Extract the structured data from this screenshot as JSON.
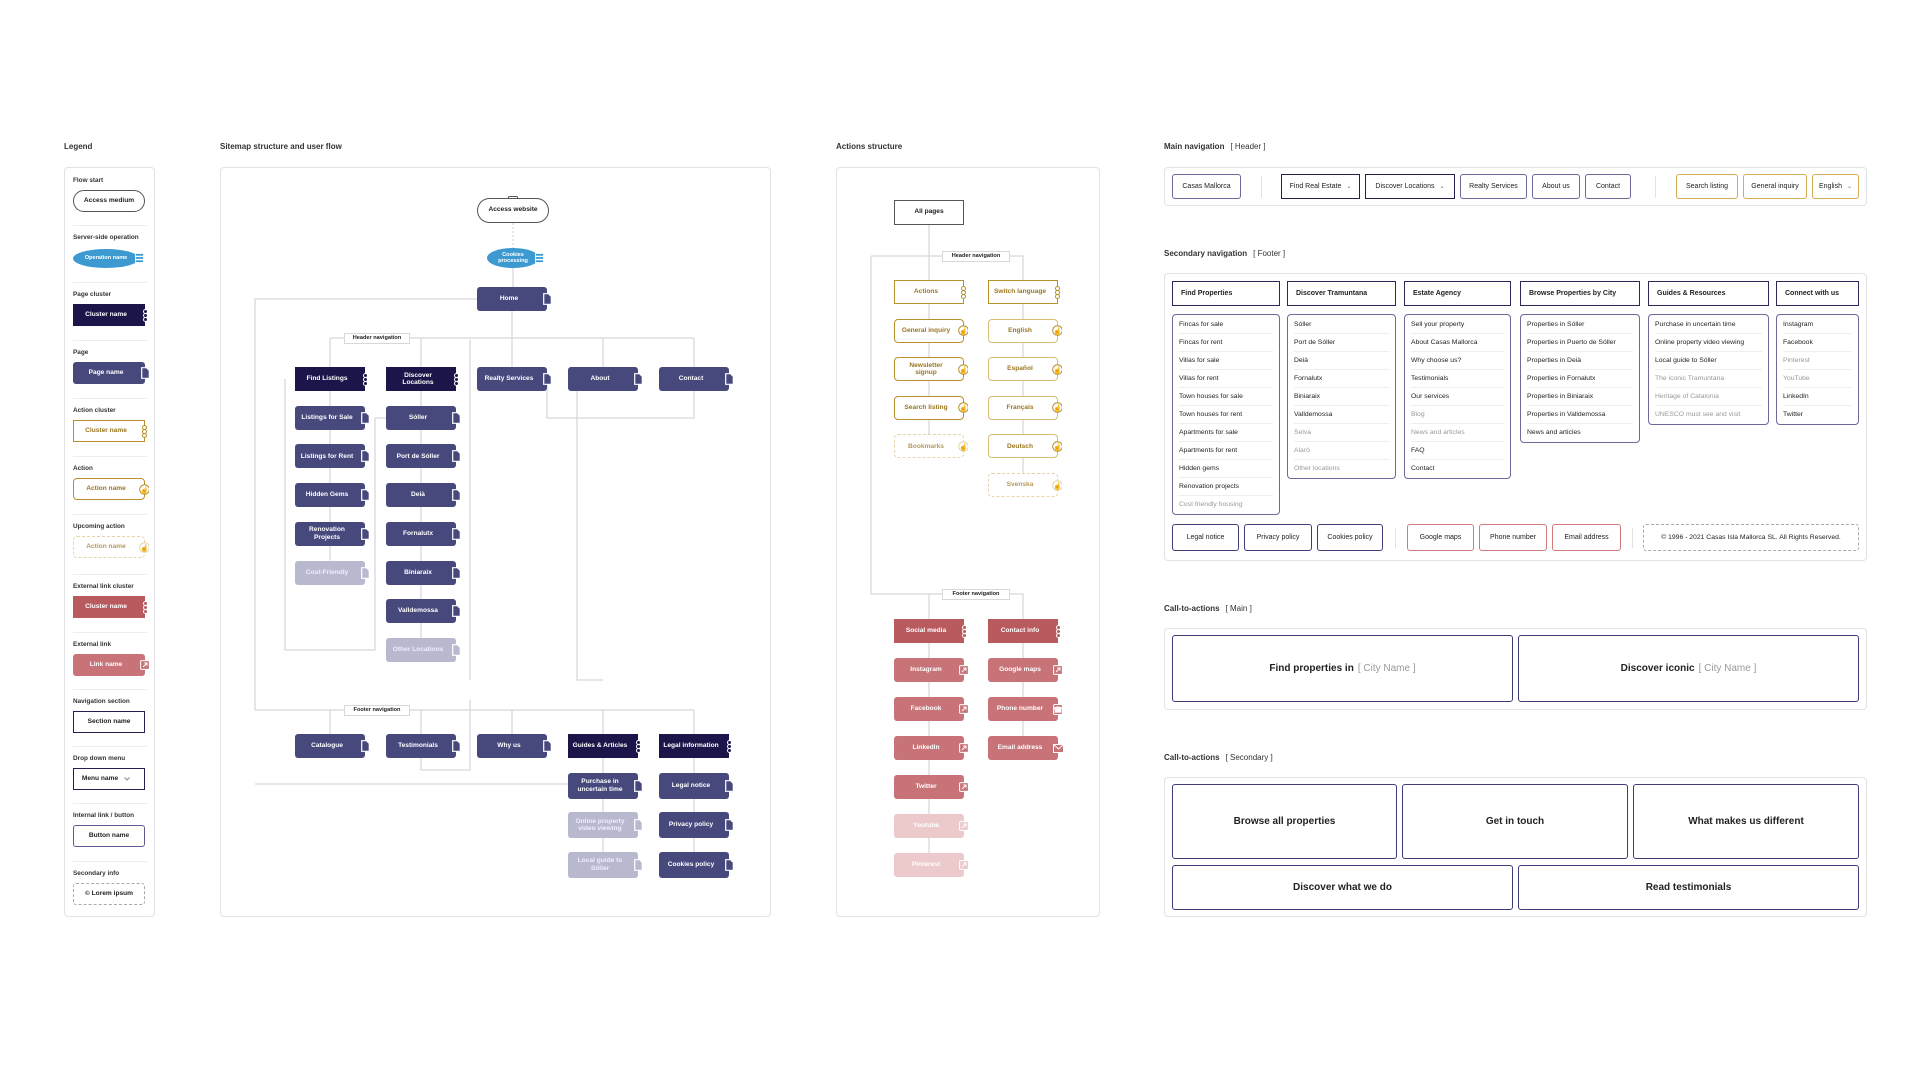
{
  "legend": {
    "title": "Legend",
    "items": [
      {
        "label": "Flow start",
        "sample": "Access medium",
        "kind": "flow"
      },
      {
        "label": "Server-side operation",
        "sample": "Operation name",
        "kind": "server"
      },
      {
        "label": "Page cluster",
        "sample": "Cluster name",
        "kind": "cluster"
      },
      {
        "label": "Page",
        "sample": "Page name",
        "kind": "page"
      },
      {
        "label": "Action cluster",
        "sample": "Cluster name",
        "kind": "action-cluster"
      },
      {
        "label": "Action",
        "sample": "Action name",
        "kind": "action"
      },
      {
        "label": "Upcoming action",
        "sample": "Action name",
        "kind": "action-up"
      },
      {
        "label": "External link cluster",
        "sample": "Cluster name",
        "kind": "ext-cluster"
      },
      {
        "label": "External link",
        "sample": "Link name",
        "kind": "ext"
      },
      {
        "label": "Navigation section",
        "sample": "Section name",
        "kind": "nav"
      },
      {
        "label": "Drop down menu",
        "sample": "Menu name",
        "kind": "dropdown"
      },
      {
        "label": "Internal link / button",
        "sample": "Button name",
        "kind": "button"
      },
      {
        "label": "Secondary info",
        "sample": "© Lorem ipsum",
        "kind": "secondary"
      }
    ]
  },
  "sitemap": {
    "title": "Sitemap structure and user flow",
    "flow_start": "Access website",
    "server_op": "Cookies processing",
    "home": "Home",
    "header_nav_label": "Header navigation",
    "footer_nav_label": "Footer navigation",
    "header_nav": [
      {
        "label": "Find Listings",
        "kind": "cluster",
        "children": [
          {
            "label": "Listings for Sale",
            "kind": "page"
          },
          {
            "label": "Listings for Rent",
            "kind": "page"
          },
          {
            "label": "Hidden Gems",
            "kind": "page"
          },
          {
            "label": "Renovation Projects",
            "kind": "page"
          },
          {
            "label": "Cost-Friendly",
            "kind": "page-up"
          }
        ]
      },
      {
        "label": "Discover Locations",
        "kind": "cluster",
        "children": [
          {
            "label": "Sóller",
            "kind": "page"
          },
          {
            "label": "Port de Sóller",
            "kind": "page"
          },
          {
            "label": "Deià",
            "kind": "page"
          },
          {
            "label": "Fornalutx",
            "kind": "page"
          },
          {
            "label": "Biniaraix",
            "kind": "page"
          },
          {
            "label": "Valldemossa",
            "kind": "page"
          },
          {
            "label": "Other Locations",
            "kind": "page-up"
          }
        ]
      },
      {
        "label": "Realty Services",
        "kind": "page",
        "children": []
      },
      {
        "label": "About",
        "kind": "page",
        "children": []
      },
      {
        "label": "Contact",
        "kind": "page",
        "children": []
      }
    ],
    "footer_nav": [
      {
        "label": "Catalogue",
        "kind": "page",
        "children": []
      },
      {
        "label": "Testimonials",
        "kind": "page",
        "children": []
      },
      {
        "label": "Why us",
        "kind": "page",
        "children": []
      },
      {
        "label": "Guides & Articles",
        "kind": "cluster",
        "children": [
          {
            "label": "Purchase in uncertain time",
            "kind": "page"
          },
          {
            "label": "Online property video viewing",
            "kind": "page-up"
          },
          {
            "label": "Local guide to Sóller",
            "kind": "page-up"
          }
        ]
      },
      {
        "label": "Legal information",
        "kind": "cluster",
        "children": [
          {
            "label": "Legal notice",
            "kind": "page"
          },
          {
            "label": "Privacy policy",
            "kind": "page"
          },
          {
            "label": "Cookies policy",
            "kind": "page"
          }
        ]
      }
    ]
  },
  "actions": {
    "title": "Actions structure",
    "all_pages": "All pages",
    "header_nav_label": "Header navigation",
    "footer_nav_label": "Footer navigation",
    "header": [
      {
        "label": "Actions",
        "kind": "action-cluster",
        "children": [
          {
            "label": "General inquiry",
            "kind": "action"
          },
          {
            "label": "Newsletter signup",
            "kind": "action"
          },
          {
            "label": "Search listing",
            "kind": "action"
          },
          {
            "label": "Bookmarks",
            "kind": "action-up"
          }
        ]
      },
      {
        "label": "Switch language",
        "kind": "action-cluster",
        "children": [
          {
            "label": "English",
            "kind": "action-light"
          },
          {
            "label": "Español",
            "kind": "action-light"
          },
          {
            "label": "Français",
            "kind": "action-light"
          },
          {
            "label": "Deutsch",
            "kind": "action-light"
          },
          {
            "label": "Svenska",
            "kind": "action-up"
          }
        ]
      }
    ],
    "footer": [
      {
        "label": "Social media",
        "kind": "ext-cluster",
        "children": [
          {
            "label": "Instagram",
            "kind": "ext",
            "icon": "external-link"
          },
          {
            "label": "Facebook",
            "kind": "ext",
            "icon": "external-link"
          },
          {
            "label": "LinkedIn",
            "kind": "ext",
            "icon": "external-link"
          },
          {
            "label": "Twitter",
            "kind": "ext",
            "icon": "external-link"
          },
          {
            "label": "Youtube",
            "kind": "ext-up",
            "icon": "external-link"
          },
          {
            "label": "Pinterest",
            "kind": "ext-up",
            "icon": "external-link"
          }
        ]
      },
      {
        "label": "Contact info",
        "kind": "ext-cluster",
        "children": [
          {
            "label": "Google maps",
            "kind": "ext",
            "icon": "external-link"
          },
          {
            "label": "Phone number",
            "kind": "ext",
            "icon": "phone"
          },
          {
            "label": "Email address",
            "kind": "ext",
            "icon": "mail"
          }
        ]
      }
    ]
  },
  "main_nav": {
    "title": "Main navigation",
    "tag": "[ Header ]",
    "buttons": [
      {
        "label": "Casas Mallorca",
        "kind": "nav"
      },
      {
        "label": "Find Real Estate",
        "kind": "dropdown"
      },
      {
        "label": "Discover Locations",
        "kind": "dropdown"
      },
      {
        "label": "Realty Services",
        "kind": "nav"
      },
      {
        "label": "About us",
        "kind": "nav"
      },
      {
        "label": "Contact",
        "kind": "nav"
      },
      {
        "label": "Search listing",
        "kind": "action"
      },
      {
        "label": "General inquiry",
        "kind": "action"
      },
      {
        "label": "English",
        "kind": "action",
        "dropdown": true
      }
    ]
  },
  "secondary_nav": {
    "title": "Secondary navigation",
    "tag": "[ Footer ]",
    "columns": [
      {
        "header": "Find Properties",
        "items": [
          {
            "label": "Fincas for sale"
          },
          {
            "label": "Fincas for rent"
          },
          {
            "label": "Villas for sale"
          },
          {
            "label": "Villas for rent"
          },
          {
            "label": "Town houses for sale"
          },
          {
            "label": "Town houses for rent"
          },
          {
            "label": "Apartments for sale"
          },
          {
            "label": "Apartments for rent"
          },
          {
            "label": "Hidden gems"
          },
          {
            "label": "Renovation projects"
          },
          {
            "label": "Cost friendly housing",
            "muted": true
          }
        ]
      },
      {
        "header": "Discover Tramuntana",
        "items": [
          {
            "label": "Sóller"
          },
          {
            "label": "Port de Sóller"
          },
          {
            "label": "Deià"
          },
          {
            "label": "Fornalutx"
          },
          {
            "label": "Biniaraix"
          },
          {
            "label": "Valldemossa"
          },
          {
            "label": "Selva",
            "muted": true
          },
          {
            "label": "Alaró",
            "muted": true
          },
          {
            "label": "Other locations",
            "muted": true
          }
        ]
      },
      {
        "header": "Estate Agency",
        "items": [
          {
            "label": "Sell your property"
          },
          {
            "label": "About Casas Mallorca"
          },
          {
            "label": "Why choose us?"
          },
          {
            "label": "Testimonials"
          },
          {
            "label": "Our services"
          },
          {
            "label": "Blog",
            "muted": true
          },
          {
            "label": "News and articles",
            "muted": true
          },
          {
            "label": "FAQ"
          },
          {
            "label": "Contact"
          }
        ]
      },
      {
        "header": "Browse Properties by City",
        "items": [
          {
            "label": "Properties in Sóller"
          },
          {
            "label": "Properties in Puerto de Sóller"
          },
          {
            "label": "Properties in Deià"
          },
          {
            "label": "Properties in Fornalutx"
          },
          {
            "label": "Properties in Biniaraix"
          },
          {
            "label": "Properties in Valldemossa"
          },
          {
            "label": "News and articles"
          }
        ]
      },
      {
        "header": "Guides & Resources",
        "items": [
          {
            "label": "Purchase in uncertain time"
          },
          {
            "label": "Online property video viewing"
          },
          {
            "label": "Local guide to Sóller"
          },
          {
            "label": "The iconic Tramuntana",
            "muted": true
          },
          {
            "label": "Heritage of Catalonia",
            "muted": true
          },
          {
            "label": "UNESCO must see and visit",
            "muted": true
          }
        ]
      },
      {
        "header": "Connect with us",
        "items": [
          {
            "label": "Instagram"
          },
          {
            "label": "Facebook"
          },
          {
            "label": "Pinterest",
            "muted": true
          },
          {
            "label": "YouTube",
            "muted": true
          },
          {
            "label": "LinkedIn"
          },
          {
            "label": "Twitter"
          }
        ]
      }
    ],
    "bottom": {
      "legal": [
        "Legal notice",
        "Privacy policy",
        "Cookies policy"
      ],
      "contact": [
        "Google maps",
        "Phone number",
        "Email address"
      ],
      "copyright": "© 1996 - 2021  Casas Isla Mallorca SL. All Rights Reserved."
    }
  },
  "cta_main": {
    "title": "Call-to-actions",
    "tag": "[ Main ]",
    "buttons": [
      {
        "label": "Find properties in",
        "placeholder": "[ City Name ]"
      },
      {
        "label": "Discover iconic",
        "placeholder": "[ City Name ]"
      }
    ]
  },
  "cta_secondary": {
    "title": "Call-to-actions",
    "tag": "[ Secondary ]",
    "buttons": [
      {
        "label": "Browse all properties"
      },
      {
        "label": "Get in touch"
      },
      {
        "label": "What makes us different"
      },
      {
        "label": "Discover what we do"
      },
      {
        "label": "Read testimonials"
      }
    ]
  },
  "colors": {
    "page": "#47497d",
    "cluster": "#1b1549",
    "server": "#3d9ad1",
    "action": "#b8912a",
    "external_cluster": "#b95a5f",
    "external_link": "#c77377",
    "nav_border": "#22204e"
  }
}
